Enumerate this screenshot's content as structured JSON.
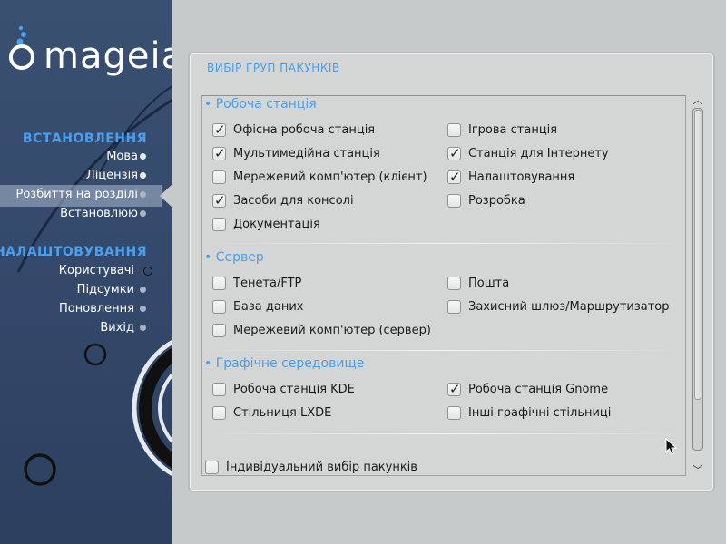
{
  "sidebar": {
    "logo_text": "mageia",
    "install_title": "ВСТАНОВЛЕННЯ",
    "install_items": [
      "Мова",
      "Ліцензія",
      "Розбиття на розділі",
      "Встановлюю"
    ],
    "config_title": "НАЛАШТОВУВАННЯ",
    "config_items": [
      "Користувачі",
      "Підсумки",
      "Поновлення",
      "Вихід"
    ],
    "active_item": "Розбиття на розділі"
  },
  "panel": {
    "title": "ВИБІР ГРУП ПАКУНКІВ",
    "groups": [
      {
        "title": "• Робоча станція",
        "options": [
          {
            "label": "Офісна робоча станція",
            "checked": true
          },
          {
            "label": "Ігрова станція",
            "checked": false
          },
          {
            "label": "Мультимедійна станція",
            "checked": true
          },
          {
            "label": "Станція для Інтернету",
            "checked": true
          },
          {
            "label": "Мережевий комп'ютер (клієнт)",
            "checked": false
          },
          {
            "label": "Налаштовування",
            "checked": true
          },
          {
            "label": "Засоби для консолі",
            "checked": true
          },
          {
            "label": "Розробка",
            "checked": false
          },
          {
            "label": "Документація",
            "checked": false
          }
        ]
      },
      {
        "title": "• Сервер",
        "options": [
          {
            "label": "Тенета/FTP",
            "checked": false
          },
          {
            "label": "Пошта",
            "checked": false
          },
          {
            "label": "База даних",
            "checked": false
          },
          {
            "label": "Захисний шлюз/Маршрутизатор",
            "checked": false
          },
          {
            "label": "Мережевий комп'ютер (сервер)",
            "checked": false
          }
        ]
      },
      {
        "title": "• Графічне середовище",
        "options": [
          {
            "label": "Робоча станція KDE",
            "checked": false
          },
          {
            "label": "Робоча станція Gnome",
            "checked": true
          },
          {
            "label": "Стільниця LXDE",
            "checked": false
          },
          {
            "label": "Інші графічні стільниці",
            "checked": false
          }
        ]
      }
    ],
    "individual_select": {
      "label": "Індивідуальний вибір пакунків",
      "checked": false
    }
  },
  "icons": {
    "scroll_up": "chevron-up-icon",
    "scroll_down": "chevron-down-icon",
    "check": "check-icon",
    "cursor": "mouse-pointer-icon"
  },
  "colors": {
    "sidebar_bg": "#34496b",
    "accent_blue": "#4a9fe8",
    "panel_bg": "#d4d6d6",
    "page_bg": "#c7cacb"
  }
}
